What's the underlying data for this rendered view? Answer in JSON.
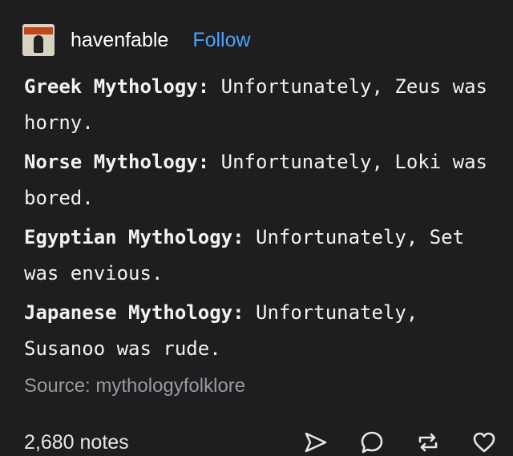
{
  "header": {
    "username": "havenfable",
    "follow_label": "Follow"
  },
  "post": {
    "paragraphs": [
      {
        "label": "Greek Mythology:",
        "text": " Unfortunately, Zeus was horny."
      },
      {
        "label": "Norse Mythology:",
        "text": " Unfortunately, Loki was bored."
      },
      {
        "label": "Egyptian Mythology:",
        "text": " Unfortunately, Set was envious."
      },
      {
        "label": "Japanese Mythology:",
        "text": " Unfortunately, Susanoo was rude."
      }
    ],
    "source": "Source: mythologyfolklore"
  },
  "footer": {
    "notes": "2,680 notes",
    "icons": [
      "share-icon",
      "reply-icon",
      "reblog-icon",
      "like-icon"
    ]
  },
  "colors": {
    "background": "#1e1e20",
    "follow": "#4aa3ff",
    "source": "#9a9a9e"
  }
}
